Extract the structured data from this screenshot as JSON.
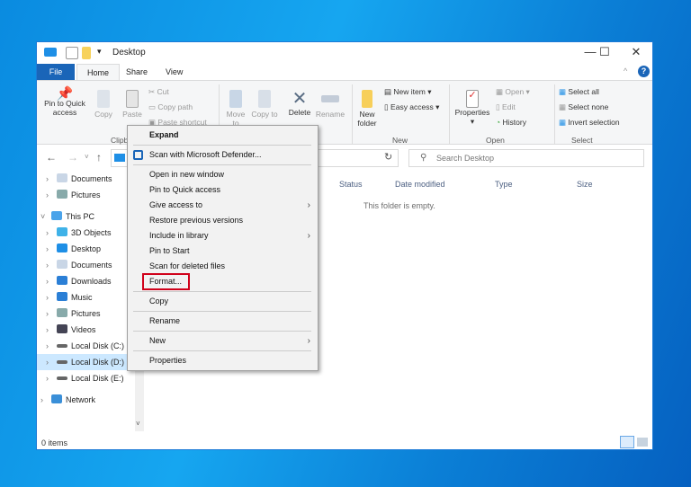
{
  "window": {
    "title": "Desktop",
    "minimize": "—",
    "maximize": "☐",
    "close": "✕"
  },
  "tabs": [
    {
      "label": "File"
    },
    {
      "label": "Home"
    },
    {
      "label": "Share"
    },
    {
      "label": "View"
    }
  ],
  "ribbon": {
    "pin": "Pin to Quick access",
    "copy": "Copy",
    "paste": "Paste",
    "cut": "Cut",
    "copy_path": "Copy path",
    "paste_shortcut": "Paste shortcut",
    "clipboard": "Clipboard",
    "move_to": "Move to",
    "copy_to": "Copy to",
    "delete": "Delete",
    "rename": "Rename",
    "new_folder": "New folder",
    "new_item": "New item ▾",
    "easy_access": "Easy access ▾",
    "new_group": "New",
    "properties": "Properties",
    "open": "Open ▾",
    "edit": "Edit",
    "history": "History",
    "open_group": "Open",
    "select_all": "Select all",
    "select_none": "Select none",
    "invert_selection": "Invert selection",
    "select_group": "Select"
  },
  "search": {
    "placeholder": "Search Desktop"
  },
  "tree": [
    {
      "label": "Documents",
      "icon": "documents-icon",
      "indent": 1
    },
    {
      "label": "Pictures",
      "icon": "pictures-icon",
      "indent": 1
    },
    {
      "label": "This PC",
      "icon": "pc-icon",
      "indent": 0,
      "expanded": true
    },
    {
      "label": "3D Objects",
      "icon": "3d-objects-icon",
      "indent": 1
    },
    {
      "label": "Desktop",
      "icon": "desktop-icon",
      "indent": 1
    },
    {
      "label": "Documents",
      "icon": "documents-icon",
      "indent": 1
    },
    {
      "label": "Downloads",
      "icon": "downloads-icon",
      "indent": 1
    },
    {
      "label": "Music",
      "icon": "music-icon",
      "indent": 1
    },
    {
      "label": "Pictures",
      "icon": "pictures-icon",
      "indent": 1
    },
    {
      "label": "Videos",
      "icon": "videos-icon",
      "indent": 1
    },
    {
      "label": "Local Disk (C:)",
      "icon": "drive-icon",
      "indent": 1
    },
    {
      "label": "Local Disk (D:)",
      "icon": "drive-icon",
      "indent": 1,
      "selected": true
    },
    {
      "label": "Local Disk (E:)",
      "icon": "drive-icon",
      "indent": 1
    },
    {
      "label": "Network",
      "icon": "network-icon",
      "indent": 0
    }
  ],
  "columns": [
    "Status",
    "Date modified",
    "Type",
    "Size"
  ],
  "empty_message": "This folder is empty.",
  "context_menu": [
    {
      "label": "Expand",
      "bold": true
    },
    {
      "sep": true
    },
    {
      "label": "Scan with Microsoft Defender..."
    },
    {
      "sep": true
    },
    {
      "label": "Open in new window"
    },
    {
      "label": "Pin to Quick access"
    },
    {
      "label": "Give access to",
      "submenu": true
    },
    {
      "label": "Restore previous versions"
    },
    {
      "label": "Include in library",
      "submenu": true
    },
    {
      "label": "Pin to Start"
    },
    {
      "label": "Scan for deleted files"
    },
    {
      "label": "Format...",
      "highlighted": true
    },
    {
      "sep": true
    },
    {
      "label": "Copy"
    },
    {
      "sep": true
    },
    {
      "label": "Rename"
    },
    {
      "sep": true
    },
    {
      "label": "New",
      "submenu": true
    },
    {
      "sep": true
    },
    {
      "label": "Properties"
    }
  ],
  "status_bar": {
    "items": "0 items"
  },
  "colors": {
    "accent": "#1a65b8",
    "highlight_box": "#d0021b",
    "selection": "#cce8ff"
  }
}
